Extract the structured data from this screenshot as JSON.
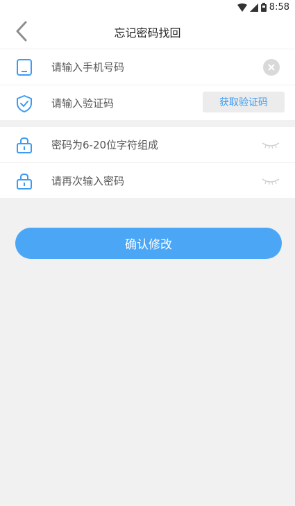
{
  "status_bar": {
    "time": "8:58"
  },
  "header": {
    "title": "忘记密码找回"
  },
  "form": {
    "phone_placeholder": "请输入手机号码",
    "code_placeholder": "请输入验证码",
    "get_code_label": "获取验证码",
    "password_placeholder": "密码为6-20位字符组成",
    "confirm_password_placeholder": "请再次输入密码"
  },
  "actions": {
    "confirm_label": "确认修改"
  },
  "colors": {
    "accent": "#4ba7f6",
    "icon_blue": "#3b9cf4"
  },
  "icons": {
    "back": "chevron-left-icon",
    "phone": "tablet-icon",
    "code": "shield-check-icon",
    "password": "lock-icon",
    "clear": "close-circle-icon",
    "visibility": "eye-closed-icon"
  }
}
